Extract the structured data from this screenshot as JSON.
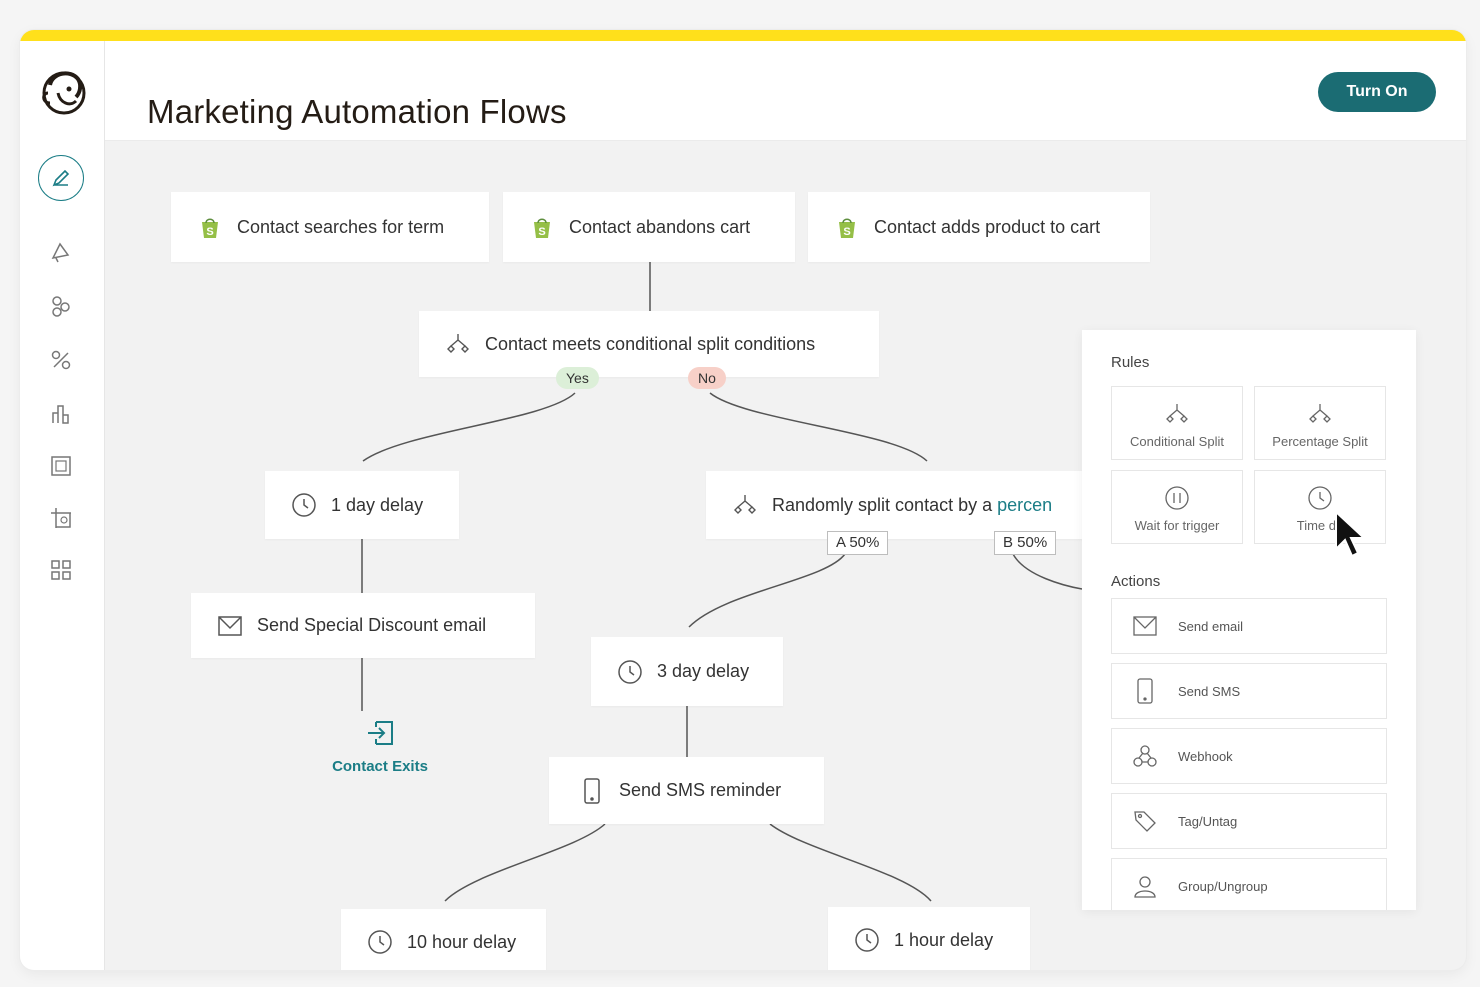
{
  "header": {
    "title": "Marketing Automation Flows",
    "turn_on_label": "Turn On"
  },
  "sidebar": {
    "logo": "mailchimp-logo",
    "active_item": "edit-icon",
    "items": [
      "campaign-icon",
      "audience-icon",
      "automation-icon",
      "analytics-icon",
      "website-icon",
      "content-icon",
      "integrations-icon"
    ]
  },
  "flow": {
    "triggers": [
      "Contact searches for term",
      "Contact abandons cart",
      "Contact adds product to cart"
    ],
    "conditional_split": {
      "label": "Contact meets conditional split conditions",
      "yes": "Yes",
      "no": "No"
    },
    "yes_branch": {
      "delay": "1 day delay",
      "email": "Send Special Discount email",
      "exit": "Contact Exits"
    },
    "random_split": {
      "label_start": "Randomly split contact by a ",
      "label_link": "percen",
      "a": "A 50%",
      "b": "B 50%"
    },
    "a_branch": {
      "delay": "3 day delay",
      "sms": "Send SMS reminder"
    },
    "sms_children": [
      "10 hour delay",
      "1 hour delay"
    ]
  },
  "panel": {
    "rules_heading": "Rules",
    "rules": [
      {
        "label": "Conditional Split",
        "icon": "split-icon"
      },
      {
        "label": "Percentage Split",
        "icon": "split-icon"
      },
      {
        "label": "Wait for trigger",
        "icon": "pause-icon"
      },
      {
        "label": "Time de",
        "icon": "clock-icon"
      }
    ],
    "actions_heading": "Actions",
    "actions": [
      {
        "label": "Send email",
        "icon": "email-icon"
      },
      {
        "label": "Send SMS",
        "icon": "phone-icon"
      },
      {
        "label": "Webhook",
        "icon": "webhook-icon"
      },
      {
        "label": "Tag/Untag",
        "icon": "tag-icon"
      },
      {
        "label": "Group/Ungroup",
        "icon": "group-icon"
      }
    ]
  },
  "colors": {
    "accent_yellow": "#ffe01b",
    "teal": "#1b6c73",
    "link_teal": "#1b7d86",
    "yes_bg": "#dcefd8",
    "no_bg": "#f7d0c8",
    "shopify_green": "#95bf47"
  }
}
